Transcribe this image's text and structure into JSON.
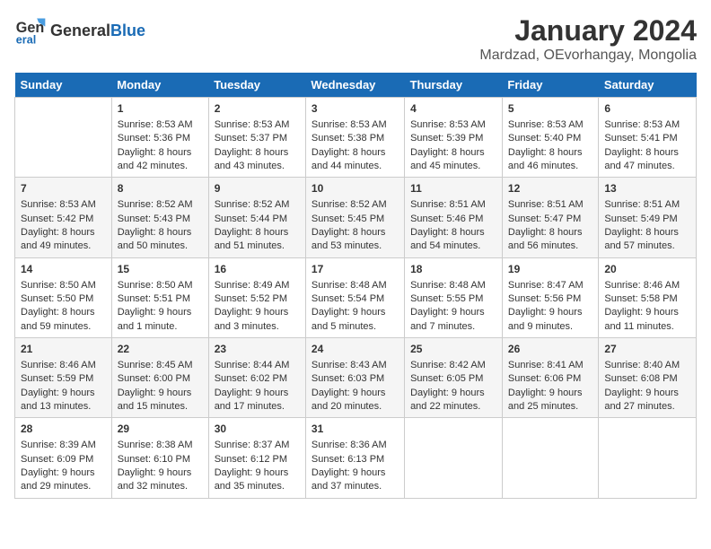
{
  "header": {
    "logo_general": "General",
    "logo_blue": "Blue",
    "month_title": "January 2024",
    "location": "Mardzad, OEvorhangay, Mongolia"
  },
  "days_of_week": [
    "Sunday",
    "Monday",
    "Tuesday",
    "Wednesday",
    "Thursday",
    "Friday",
    "Saturday"
  ],
  "weeks": [
    [
      {
        "day": "",
        "content": ""
      },
      {
        "day": "1",
        "content": "Sunrise: 8:53 AM\nSunset: 5:36 PM\nDaylight: 8 hours\nand 42 minutes."
      },
      {
        "day": "2",
        "content": "Sunrise: 8:53 AM\nSunset: 5:37 PM\nDaylight: 8 hours\nand 43 minutes."
      },
      {
        "day": "3",
        "content": "Sunrise: 8:53 AM\nSunset: 5:38 PM\nDaylight: 8 hours\nand 44 minutes."
      },
      {
        "day": "4",
        "content": "Sunrise: 8:53 AM\nSunset: 5:39 PM\nDaylight: 8 hours\nand 45 minutes."
      },
      {
        "day": "5",
        "content": "Sunrise: 8:53 AM\nSunset: 5:40 PM\nDaylight: 8 hours\nand 46 minutes."
      },
      {
        "day": "6",
        "content": "Sunrise: 8:53 AM\nSunset: 5:41 PM\nDaylight: 8 hours\nand 47 minutes."
      }
    ],
    [
      {
        "day": "7",
        "content": "Sunrise: 8:53 AM\nSunset: 5:42 PM\nDaylight: 8 hours\nand 49 minutes."
      },
      {
        "day": "8",
        "content": "Sunrise: 8:52 AM\nSunset: 5:43 PM\nDaylight: 8 hours\nand 50 minutes."
      },
      {
        "day": "9",
        "content": "Sunrise: 8:52 AM\nSunset: 5:44 PM\nDaylight: 8 hours\nand 51 minutes."
      },
      {
        "day": "10",
        "content": "Sunrise: 8:52 AM\nSunset: 5:45 PM\nDaylight: 8 hours\nand 53 minutes."
      },
      {
        "day": "11",
        "content": "Sunrise: 8:51 AM\nSunset: 5:46 PM\nDaylight: 8 hours\nand 54 minutes."
      },
      {
        "day": "12",
        "content": "Sunrise: 8:51 AM\nSunset: 5:47 PM\nDaylight: 8 hours\nand 56 minutes."
      },
      {
        "day": "13",
        "content": "Sunrise: 8:51 AM\nSunset: 5:49 PM\nDaylight: 8 hours\nand 57 minutes."
      }
    ],
    [
      {
        "day": "14",
        "content": "Sunrise: 8:50 AM\nSunset: 5:50 PM\nDaylight: 8 hours\nand 59 minutes."
      },
      {
        "day": "15",
        "content": "Sunrise: 8:50 AM\nSunset: 5:51 PM\nDaylight: 9 hours\nand 1 minute."
      },
      {
        "day": "16",
        "content": "Sunrise: 8:49 AM\nSunset: 5:52 PM\nDaylight: 9 hours\nand 3 minutes."
      },
      {
        "day": "17",
        "content": "Sunrise: 8:48 AM\nSunset: 5:54 PM\nDaylight: 9 hours\nand 5 minutes."
      },
      {
        "day": "18",
        "content": "Sunrise: 8:48 AM\nSunset: 5:55 PM\nDaylight: 9 hours\nand 7 minutes."
      },
      {
        "day": "19",
        "content": "Sunrise: 8:47 AM\nSunset: 5:56 PM\nDaylight: 9 hours\nand 9 minutes."
      },
      {
        "day": "20",
        "content": "Sunrise: 8:46 AM\nSunset: 5:58 PM\nDaylight: 9 hours\nand 11 minutes."
      }
    ],
    [
      {
        "day": "21",
        "content": "Sunrise: 8:46 AM\nSunset: 5:59 PM\nDaylight: 9 hours\nand 13 minutes."
      },
      {
        "day": "22",
        "content": "Sunrise: 8:45 AM\nSunset: 6:00 PM\nDaylight: 9 hours\nand 15 minutes."
      },
      {
        "day": "23",
        "content": "Sunrise: 8:44 AM\nSunset: 6:02 PM\nDaylight: 9 hours\nand 17 minutes."
      },
      {
        "day": "24",
        "content": "Sunrise: 8:43 AM\nSunset: 6:03 PM\nDaylight: 9 hours\nand 20 minutes."
      },
      {
        "day": "25",
        "content": "Sunrise: 8:42 AM\nSunset: 6:05 PM\nDaylight: 9 hours\nand 22 minutes."
      },
      {
        "day": "26",
        "content": "Sunrise: 8:41 AM\nSunset: 6:06 PM\nDaylight: 9 hours\nand 25 minutes."
      },
      {
        "day": "27",
        "content": "Sunrise: 8:40 AM\nSunset: 6:08 PM\nDaylight: 9 hours\nand 27 minutes."
      }
    ],
    [
      {
        "day": "28",
        "content": "Sunrise: 8:39 AM\nSunset: 6:09 PM\nDaylight: 9 hours\nand 29 minutes."
      },
      {
        "day": "29",
        "content": "Sunrise: 8:38 AM\nSunset: 6:10 PM\nDaylight: 9 hours\nand 32 minutes."
      },
      {
        "day": "30",
        "content": "Sunrise: 8:37 AM\nSunset: 6:12 PM\nDaylight: 9 hours\nand 35 minutes."
      },
      {
        "day": "31",
        "content": "Sunrise: 8:36 AM\nSunset: 6:13 PM\nDaylight: 9 hours\nand 37 minutes."
      },
      {
        "day": "",
        "content": ""
      },
      {
        "day": "",
        "content": ""
      },
      {
        "day": "",
        "content": ""
      }
    ]
  ]
}
